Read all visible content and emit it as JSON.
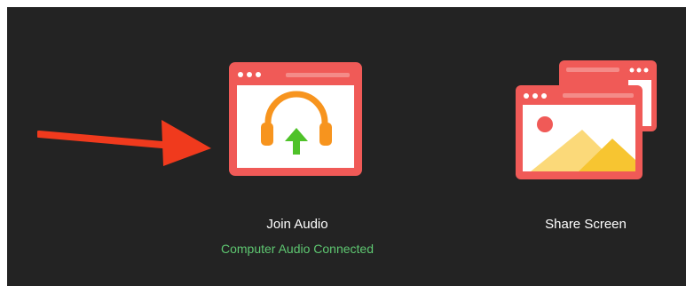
{
  "options": {
    "join_audio": {
      "label": "Join Audio",
      "status": "Computer Audio Connected",
      "icon": "headphones-upload-icon"
    },
    "share_screen": {
      "label": "Share Screen",
      "icon": "share-screen-icon"
    }
  },
  "annotation": {
    "icon": "red-arrow-icon",
    "color": "#f03a1d"
  },
  "colors": {
    "background": "#232323",
    "tile_red": "#f05a57",
    "status_green": "#5ec771",
    "headphone_orange": "#f7941e",
    "upload_green": "#4fc229"
  }
}
